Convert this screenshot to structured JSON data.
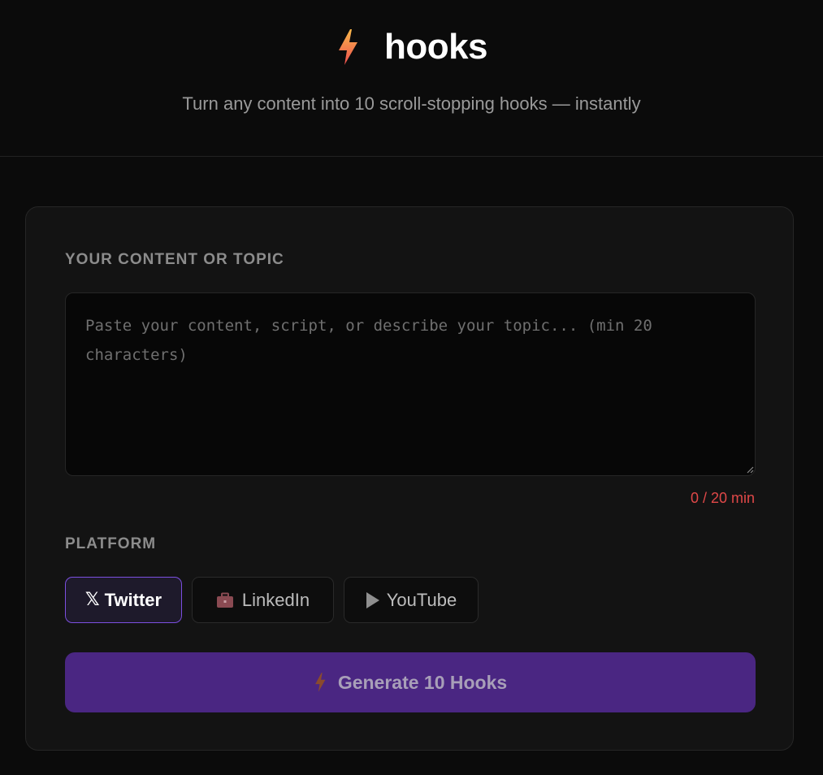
{
  "header": {
    "brand_name": "hooks",
    "tagline": "Turn any content into 10 scroll-stopping hooks — instantly",
    "logo_icon": "lightning-bolt-icon"
  },
  "form": {
    "content_label": "YOUR CONTENT OR TOPIC",
    "content_placeholder": "Paste your content, script, or describe your topic... (min 20 characters)",
    "content_value": "",
    "char_count": "0 / 20 min",
    "platform_label": "PLATFORM",
    "platforms": [
      {
        "label": "Twitter",
        "icon": "x-logo-icon",
        "icon_glyph": "𝕏",
        "selected": true
      },
      {
        "label": "LinkedIn",
        "icon": "briefcase-icon",
        "selected": false
      },
      {
        "label": "YouTube",
        "icon": "play-icon",
        "selected": false
      }
    ],
    "generate_label": "Generate 10 Hooks"
  },
  "colors": {
    "background": "#0b0b0b",
    "card": "#131313",
    "accent_purple": "#7c4fe0",
    "button_purple": "#4a2682",
    "error_red": "#e04848",
    "bolt_gradient_top": "#f7b84a",
    "bolt_gradient_bottom": "#ef4e4e"
  }
}
